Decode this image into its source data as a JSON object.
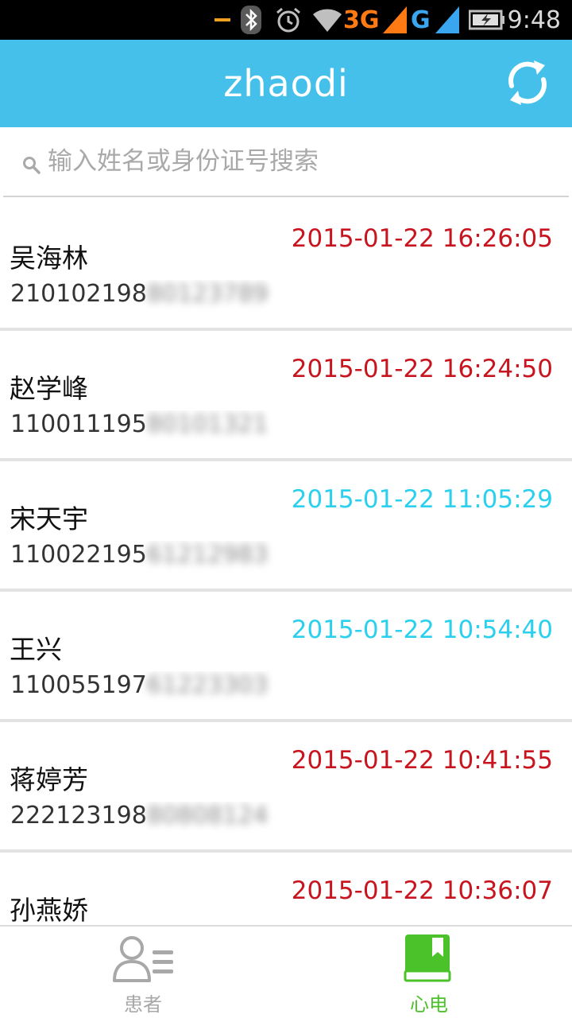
{
  "status_bar": {
    "time": "9:48",
    "network_primary": "3G",
    "network_secondary": "G",
    "icons": [
      "notification-icon",
      "bluetooth-icon",
      "alarm-icon",
      "wifi-icon",
      "signal-icon",
      "battery-icon"
    ]
  },
  "header": {
    "title": "zhaodi",
    "refresh_icon": "refresh-icon"
  },
  "search": {
    "placeholder": "输入姓名或身份证号搜索",
    "value": ""
  },
  "colors": {
    "header_bg": "#45c0ea",
    "time_red": "#c8141e",
    "time_cyan": "#2ad0ee",
    "tab_active": "#4cc22a",
    "tab_inactive": "#a8a8a8"
  },
  "patients": [
    {
      "name": "吴海林",
      "id_visible": "210102198",
      "id_blurred": "80123789",
      "time": "2015-01-22 16:26:05",
      "time_color": "red"
    },
    {
      "name": "赵学峰",
      "id_visible": "110011195",
      "id_blurred": "80101321",
      "time": "2015-01-22 16:24:50",
      "time_color": "red"
    },
    {
      "name": "宋天宇",
      "id_visible": "110022195",
      "id_blurred": "61212983",
      "time": "2015-01-22 11:05:29",
      "time_color": "cyan"
    },
    {
      "name": "王兴",
      "id_visible": "110055197",
      "id_blurred": "61223303",
      "time": "2015-01-22 10:54:40",
      "time_color": "cyan"
    },
    {
      "name": "蒋婷芳",
      "id_visible": "222123198",
      "id_blurred": "80808124",
      "time": "2015-01-22 10:41:55",
      "time_color": "red"
    },
    {
      "name": "孙燕娇",
      "id_visible": "",
      "id_blurred": "",
      "time": "2015-01-22 10:36:07",
      "time_color": "red"
    }
  ],
  "tabs": [
    {
      "label": "患者",
      "icon": "patients-icon",
      "active": false
    },
    {
      "label": "心电",
      "icon": "ecg-book-icon",
      "active": true
    }
  ]
}
